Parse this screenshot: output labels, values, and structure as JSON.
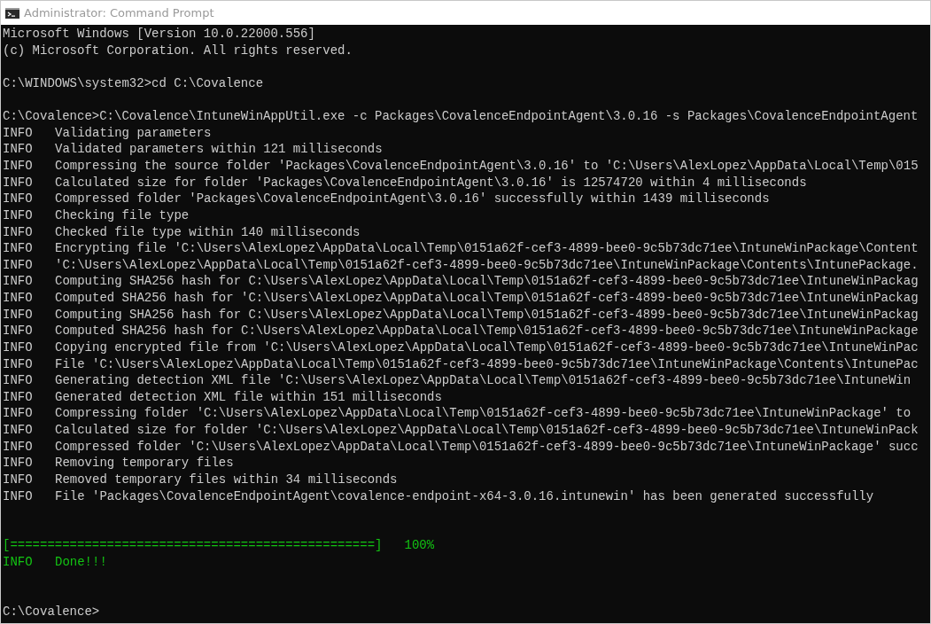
{
  "window": {
    "title": "Administrator: Command Prompt"
  },
  "console": [
    {
      "kind": "plain",
      "text": "Microsoft Windows [Version 10.0.22000.556]"
    },
    {
      "kind": "plain",
      "text": "(c) Microsoft Corporation. All rights reserved."
    },
    {
      "kind": "blank"
    },
    {
      "kind": "plain",
      "text": "C:\\WINDOWS\\system32>cd C:\\Covalence"
    },
    {
      "kind": "blank"
    },
    {
      "kind": "plain",
      "text": "C:\\Covalence>C:\\Covalence\\IntuneWinAppUtil.exe -c Packages\\CovalenceEndpointAgent\\3.0.16 -s Packages\\CovalenceEndpointAgent"
    },
    {
      "kind": "info",
      "level_label": "INFO",
      "text": "Validating parameters"
    },
    {
      "kind": "info",
      "level_label": "INFO",
      "text": "Validated parameters within 121 milliseconds"
    },
    {
      "kind": "info",
      "level_label": "INFO",
      "text": "Compressing the source folder 'Packages\\CovalenceEndpointAgent\\3.0.16' to 'C:\\Users\\AlexLopez\\AppData\\Local\\Temp\\015"
    },
    {
      "kind": "info",
      "level_label": "INFO",
      "text": "Calculated size for folder 'Packages\\CovalenceEndpointAgent\\3.0.16' is 12574720 within 4 milliseconds"
    },
    {
      "kind": "info",
      "level_label": "INFO",
      "text": "Compressed folder 'Packages\\CovalenceEndpointAgent\\3.0.16' successfully within 1439 milliseconds"
    },
    {
      "kind": "info",
      "level_label": "INFO",
      "text": "Checking file type"
    },
    {
      "kind": "info",
      "level_label": "INFO",
      "text": "Checked file type within 140 milliseconds"
    },
    {
      "kind": "info",
      "level_label": "INFO",
      "text": "Encrypting file 'C:\\Users\\AlexLopez\\AppData\\Local\\Temp\\0151a62f-cef3-4899-bee0-9c5b73dc71ee\\IntuneWinPackage\\Content"
    },
    {
      "kind": "info",
      "level_label": "INFO",
      "text": "'C:\\Users\\AlexLopez\\AppData\\Local\\Temp\\0151a62f-cef3-4899-bee0-9c5b73dc71ee\\IntuneWinPackage\\Contents\\IntunePackage."
    },
    {
      "kind": "info",
      "level_label": "INFO",
      "text": "Computing SHA256 hash for C:\\Users\\AlexLopez\\AppData\\Local\\Temp\\0151a62f-cef3-4899-bee0-9c5b73dc71ee\\IntuneWinPackag"
    },
    {
      "kind": "info",
      "level_label": "INFO",
      "text": "Computed SHA256 hash for 'C:\\Users\\AlexLopez\\AppData\\Local\\Temp\\0151a62f-cef3-4899-bee0-9c5b73dc71ee\\IntuneWinPackag"
    },
    {
      "kind": "info",
      "level_label": "INFO",
      "text": "Computing SHA256 hash for C:\\Users\\AlexLopez\\AppData\\Local\\Temp\\0151a62f-cef3-4899-bee0-9c5b73dc71ee\\IntuneWinPackag"
    },
    {
      "kind": "info",
      "level_label": "INFO",
      "text": "Computed SHA256 hash for C:\\Users\\AlexLopez\\AppData\\Local\\Temp\\0151a62f-cef3-4899-bee0-9c5b73dc71ee\\IntuneWinPackage"
    },
    {
      "kind": "info",
      "level_label": "INFO",
      "text": "Copying encrypted file from 'C:\\Users\\AlexLopez\\AppData\\Local\\Temp\\0151a62f-cef3-4899-bee0-9c5b73dc71ee\\IntuneWinPac"
    },
    {
      "kind": "info",
      "level_label": "INFO",
      "text": "File 'C:\\Users\\AlexLopez\\AppData\\Local\\Temp\\0151a62f-cef3-4899-bee0-9c5b73dc71ee\\IntuneWinPackage\\Contents\\IntunePac"
    },
    {
      "kind": "info",
      "level_label": "INFO",
      "text": "Generating detection XML file 'C:\\Users\\AlexLopez\\AppData\\Local\\Temp\\0151a62f-cef3-4899-bee0-9c5b73dc71ee\\IntuneWin"
    },
    {
      "kind": "info",
      "level_label": "INFO",
      "text": "Generated detection XML file within 151 milliseconds"
    },
    {
      "kind": "info",
      "level_label": "INFO",
      "text": "Compressing folder 'C:\\Users\\AlexLopez\\AppData\\Local\\Temp\\0151a62f-cef3-4899-bee0-9c5b73dc71ee\\IntuneWinPackage' to"
    },
    {
      "kind": "info",
      "level_label": "INFO",
      "text": "Calculated size for folder 'C:\\Users\\AlexLopez\\AppData\\Local\\Temp\\0151a62f-cef3-4899-bee0-9c5b73dc71ee\\IntuneWinPack"
    },
    {
      "kind": "info",
      "level_label": "INFO",
      "text": "Compressed folder 'C:\\Users\\AlexLopez\\AppData\\Local\\Temp\\0151a62f-cef3-4899-bee0-9c5b73dc71ee\\IntuneWinPackage' succ"
    },
    {
      "kind": "info",
      "level_label": "INFO",
      "text": "Removing temporary files"
    },
    {
      "kind": "info",
      "level_label": "INFO",
      "text": "Removed temporary files within 34 milliseconds"
    },
    {
      "kind": "info",
      "level_label": "INFO",
      "text": "File 'Packages\\CovalenceEndpointAgent\\covalence-endpoint-x64-3.0.16.intunewin' has been generated successfully"
    },
    {
      "kind": "blank"
    },
    {
      "kind": "blank"
    },
    {
      "kind": "progress",
      "bar": "[=================================================]",
      "percent": "100%"
    },
    {
      "kind": "success",
      "level_label": "INFO",
      "text": "Done!!!"
    },
    {
      "kind": "blank"
    },
    {
      "kind": "blank"
    },
    {
      "kind": "plain",
      "text": "C:\\Covalence>"
    }
  ]
}
